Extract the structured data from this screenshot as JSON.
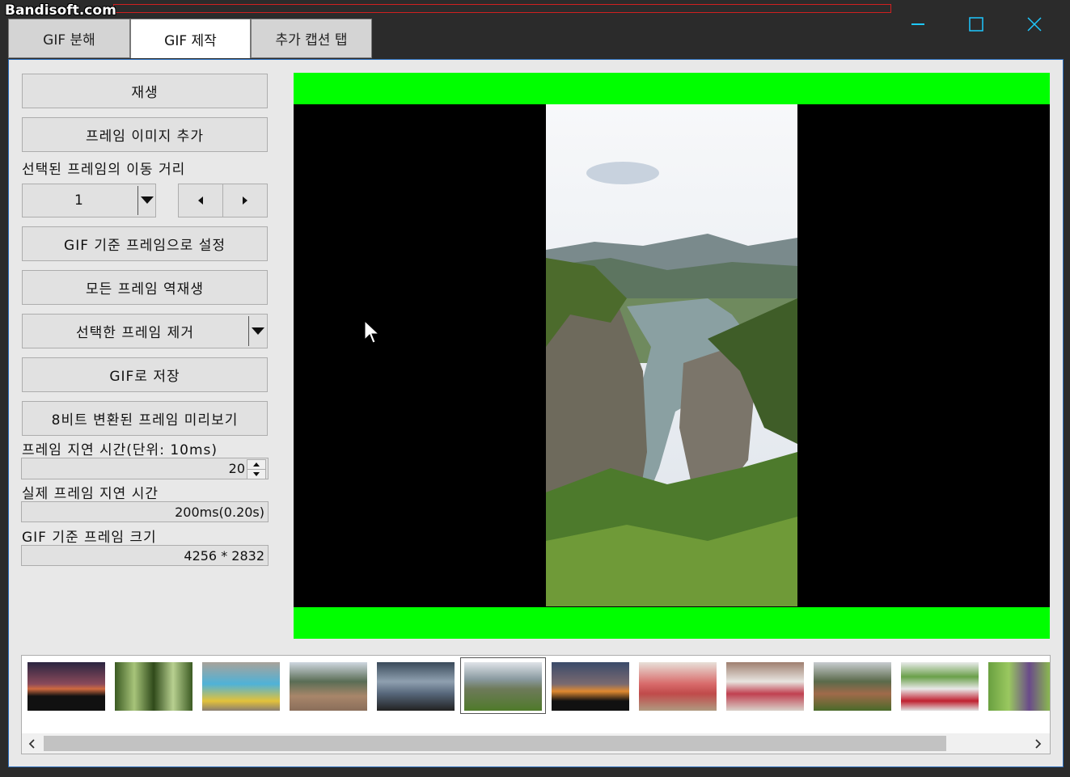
{
  "watermark": "Bandisoft.com",
  "tabs": [
    {
      "label": "GIF 분해",
      "active": false
    },
    {
      "label": "GIF 제작",
      "active": true
    },
    {
      "label": "추가 캡션 탭",
      "active": false
    }
  ],
  "controls": {
    "play_label": "재생",
    "add_frame_label": "프레임 이미지 추가",
    "move_distance_label": "선택된 프레임의 이동 거리",
    "move_distance_value": "1",
    "set_base_frame_label": "GIF 기준 프레임으로 설정",
    "reverse_all_label": "모든 프레임 역재생",
    "remove_selected_label": "선택한 프레임 제거",
    "save_gif_label": "GIF로 저장",
    "preview_8bit_label": "8비트 변환된 프레임 미리보기",
    "delay_label": "프레임 지연 시간(단위: 10ms)",
    "delay_value": "20",
    "actual_delay_label": "실제 프레임 지연 시간",
    "actual_delay_value": "200ms(0.20s)",
    "base_size_label": "GIF 기준 프레임 크기",
    "base_size_value": "4256 * 2832"
  },
  "colors": {
    "accent_green": "#00ff00",
    "window_accent": "#1ec8ff"
  },
  "icons": {
    "minimize": "minimize-icon",
    "maximize": "maximize-icon",
    "close": "close-icon"
  },
  "thumbnails": [
    {
      "name": "sunset-night"
    },
    {
      "name": "forest-trees"
    },
    {
      "name": "blue-drink"
    },
    {
      "name": "rock-mountain-view"
    },
    {
      "name": "cloudy-sky"
    },
    {
      "name": "river-valley",
      "selected": true
    },
    {
      "name": "orange-sunset"
    },
    {
      "name": "red-drink"
    },
    {
      "name": "cream-dessert"
    },
    {
      "name": "valley-cliffs"
    },
    {
      "name": "cherry-drink"
    },
    {
      "name": "purple-flower"
    }
  ]
}
